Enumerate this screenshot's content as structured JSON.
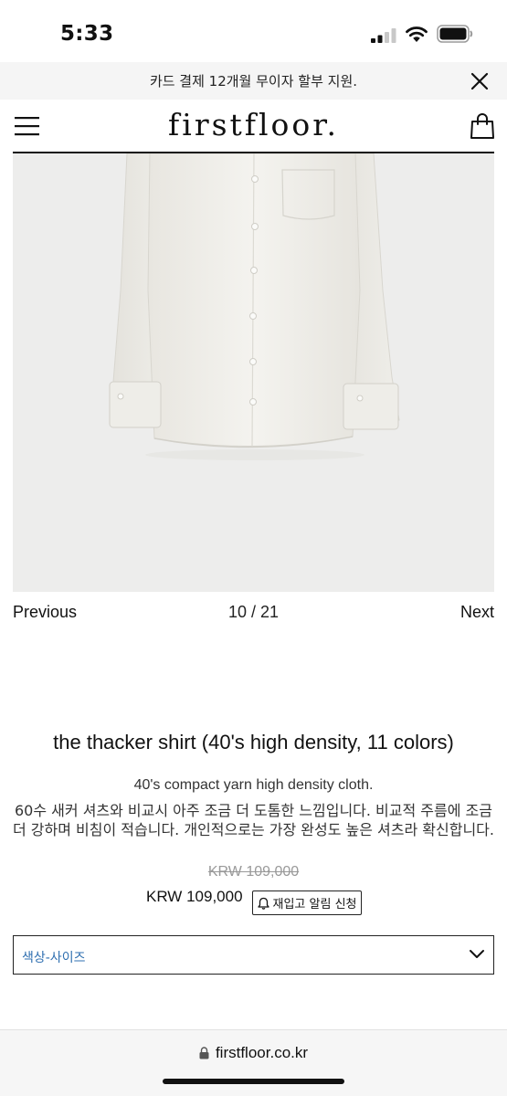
{
  "status_bar": {
    "time": "5:33",
    "icons": [
      "signal-icon",
      "wifi-icon",
      "battery-icon"
    ]
  },
  "promo_banner": {
    "text": "카드 결제 12개월 무이자 할부 지원.",
    "close_icon": "close-icon"
  },
  "header": {
    "logo": "firstfloor.",
    "menu_icon": "hamburger-menu-icon",
    "cart_icon": "shopping-bag-icon"
  },
  "gallery": {
    "prev_label": "Previous",
    "counter": "10 / 21",
    "next_label": "Next",
    "current_index": 10,
    "total": 21
  },
  "product": {
    "title": "the thacker shirt (40's high density, 11 colors)",
    "subtitle": "40's compact yarn high density cloth.",
    "description": "60수 새커 셔츠와 비교시 아주 조금 더 도톰한 느낌입니다. 비교적 주름에 조금 더 강하며 비침이 적습니다. 개인적으로는 가장 완성도 높은 셔츠라 확신합니다.",
    "price_original": "KRW 109,000",
    "price_current": "KRW 109,000",
    "restock_label": "재입고 알림 신청",
    "restock_icon": "bell-icon"
  },
  "options": {
    "selected_label": "색상-사이즈",
    "chevron_icon": "chevron-down-icon"
  },
  "browser": {
    "url": "firstfloor.co.kr",
    "lock_icon": "lock-icon"
  },
  "colors": {
    "link_blue": "#2f6fb0",
    "image_bg": "#ededec",
    "shirt": "#f3f2ee",
    "strike_gray": "#999999"
  }
}
